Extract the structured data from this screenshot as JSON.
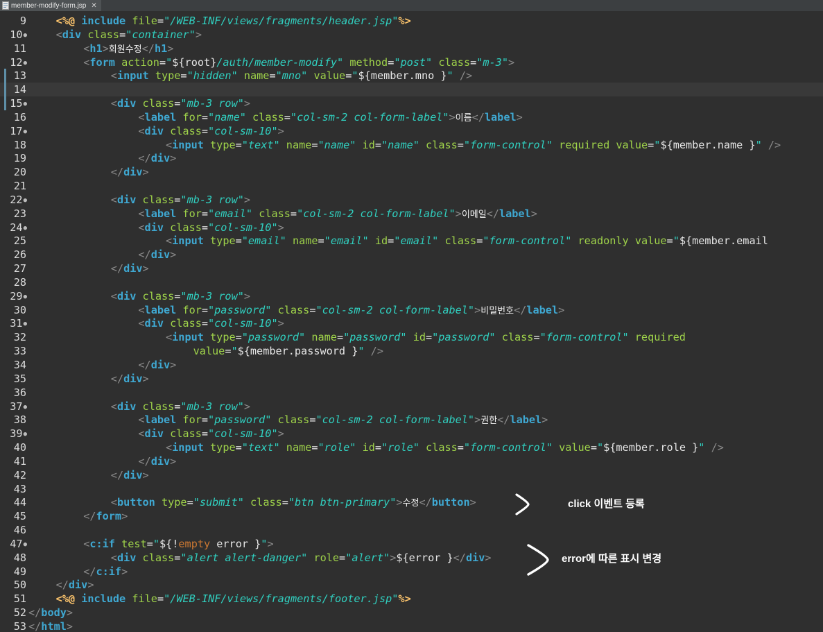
{
  "tab": {
    "filename": "member-modify-form.jsp"
  },
  "editor": {
    "current_line": 14,
    "lines": [
      {
        "n": "9",
        "fold": false,
        "code": "<span class=\"dl\">&lt;%@</span> <span class=\"tg\">include</span> <span class=\"at\">file</span>=<span class=\"st\">\"/WEB-INF/views/fragments/header.jsp\"</span><span class=\"dl\">%&gt;</span>",
        "indent": 2
      },
      {
        "n": "10",
        "fold": true,
        "code": "<span class=\"br\">&lt;</span><span class=\"tg\">div</span> <span class=\"at\">class</span>=<span class=\"st\">\"container\"</span><span class=\"br\">&gt;</span>",
        "indent": 2
      },
      {
        "n": "11",
        "fold": false,
        "code": "<span class=\"br\">&lt;</span><span class=\"tg\">h1</span><span class=\"br\">&gt;</span><span class=\"ko\">회원수정</span><span class=\"br\">&lt;/</span><span class=\"tg\">h1</span><span class=\"br\">&gt;</span>",
        "indent": 4
      },
      {
        "n": "12",
        "fold": true,
        "code": "<span class=\"br\">&lt;</span><span class=\"tg\">form</span> <span class=\"at\">action</span>=<span class=\"st\">\"</span><span class=\"ex\">${root}</span><span class=\"st\">/auth/member-modify\"</span> <span class=\"at\">method</span>=<span class=\"st\">\"post\"</span> <span class=\"at\">class</span>=<span class=\"st\">\"m-3\"</span><span class=\"br\">&gt;</span>",
        "indent": 4
      },
      {
        "n": "13",
        "fold": false,
        "code": "<span class=\"br\">&lt;</span><span class=\"tg\">input</span> <span class=\"at\">type</span>=<span class=\"st\">\"hidden\"</span> <span class=\"at\">name</span>=<span class=\"st\">\"mno\"</span> <span class=\"at\">value</span>=<span class=\"st\">\"</span><span class=\"ex\">${member.mno }</span><span class=\"st\">\"</span> <span class=\"br\">/&gt;</span>",
        "indent": 6,
        "change": true
      },
      {
        "n": "14",
        "fold": false,
        "code": "",
        "indent": 0,
        "change": true
      },
      {
        "n": "15",
        "fold": true,
        "code": "<span class=\"br\">&lt;</span><span class=\"tg\">div</span> <span class=\"at\">class</span>=<span class=\"st\">\"mb-3 row\"</span><span class=\"br\">&gt;</span>",
        "indent": 6,
        "change": true
      },
      {
        "n": "16",
        "fold": false,
        "code": "<span class=\"br\">&lt;</span><span class=\"tg\">label</span> <span class=\"at\">for</span>=<span class=\"st\">\"name\"</span> <span class=\"at\">class</span>=<span class=\"st\">\"col-sm-2 col-form-label\"</span><span class=\"br\">&gt;</span><span class=\"ko\">이름</span><span class=\"br\">&lt;/</span><span class=\"tg\">label</span><span class=\"br\">&gt;</span>",
        "indent": 8
      },
      {
        "n": "17",
        "fold": true,
        "code": "<span class=\"br\">&lt;</span><span class=\"tg\">div</span> <span class=\"at\">class</span>=<span class=\"st\">\"col-sm-10\"</span><span class=\"br\">&gt;</span>",
        "indent": 8
      },
      {
        "n": "18",
        "fold": false,
        "code": "<span class=\"br\">&lt;</span><span class=\"tg\">input</span> <span class=\"at\">type</span>=<span class=\"st\">\"text\"</span> <span class=\"at\">name</span>=<span class=\"st\">\"name\"</span> <span class=\"at\">id</span>=<span class=\"st\">\"name\"</span> <span class=\"at\">class</span>=<span class=\"st\">\"form-control\"</span> <span class=\"at\">required</span> <span class=\"at\">value</span>=<span class=\"st\">\"</span><span class=\"ex\">${member.name }</span><span class=\"st\">\"</span> <span class=\"br\">/&gt;</span>",
        "indent": 10
      },
      {
        "n": "19",
        "fold": false,
        "code": "<span class=\"br\">&lt;/</span><span class=\"tg\">div</span><span class=\"br\">&gt;</span>",
        "indent": 8
      },
      {
        "n": "20",
        "fold": false,
        "code": "<span class=\"br\">&lt;/</span><span class=\"tg\">div</span><span class=\"br\">&gt;</span>",
        "indent": 6
      },
      {
        "n": "21",
        "fold": false,
        "code": "",
        "indent": 0
      },
      {
        "n": "22",
        "fold": true,
        "code": "<span class=\"br\">&lt;</span><span class=\"tg\">div</span> <span class=\"at\">class</span>=<span class=\"st\">\"mb-3 row\"</span><span class=\"br\">&gt;</span>",
        "indent": 6
      },
      {
        "n": "23",
        "fold": false,
        "code": "<span class=\"br\">&lt;</span><span class=\"tg\">label</span> <span class=\"at\">for</span>=<span class=\"st\">\"email\"</span> <span class=\"at\">class</span>=<span class=\"st\">\"col-sm-2 col-form-label\"</span><span class=\"br\">&gt;</span><span class=\"ko\">이메일</span><span class=\"br\">&lt;/</span><span class=\"tg\">label</span><span class=\"br\">&gt;</span>",
        "indent": 8
      },
      {
        "n": "24",
        "fold": true,
        "code": "<span class=\"br\">&lt;</span><span class=\"tg\">div</span> <span class=\"at\">class</span>=<span class=\"st\">\"col-sm-10\"</span><span class=\"br\">&gt;</span>",
        "indent": 8
      },
      {
        "n": "25",
        "fold": false,
        "code": "<span class=\"br\">&lt;</span><span class=\"tg\">input</span> <span class=\"at\">type</span>=<span class=\"st\">\"email\"</span> <span class=\"at\">name</span>=<span class=\"st\">\"email\"</span> <span class=\"at\">id</span>=<span class=\"st\">\"email\"</span> <span class=\"at\">class</span>=<span class=\"st\">\"form-control\"</span> <span class=\"at\">readonly</span> <span class=\"at\">value</span>=<span class=\"st\">\"</span><span class=\"ex\">${member.email</span>",
        "indent": 10
      },
      {
        "n": "26",
        "fold": false,
        "code": "<span class=\"br\">&lt;/</span><span class=\"tg\">div</span><span class=\"br\">&gt;</span>",
        "indent": 8
      },
      {
        "n": "27",
        "fold": false,
        "code": "<span class=\"br\">&lt;/</span><span class=\"tg\">div</span><span class=\"br\">&gt;</span>",
        "indent": 6
      },
      {
        "n": "28",
        "fold": false,
        "code": "",
        "indent": 0
      },
      {
        "n": "29",
        "fold": true,
        "code": "<span class=\"br\">&lt;</span><span class=\"tg\">div</span> <span class=\"at\">class</span>=<span class=\"st\">\"mb-3 row\"</span><span class=\"br\">&gt;</span>",
        "indent": 6
      },
      {
        "n": "30",
        "fold": false,
        "code": "<span class=\"br\">&lt;</span><span class=\"tg\">label</span> <span class=\"at\">for</span>=<span class=\"st\">\"password\"</span> <span class=\"at\">class</span>=<span class=\"st\">\"col-sm-2 col-form-label\"</span><span class=\"br\">&gt;</span><span class=\"ko\">비밀번호</span><span class=\"br\">&lt;/</span><span class=\"tg\">label</span><span class=\"br\">&gt;</span>",
        "indent": 8
      },
      {
        "n": "31",
        "fold": true,
        "code": "<span class=\"br\">&lt;</span><span class=\"tg\">div</span> <span class=\"at\">class</span>=<span class=\"st\">\"col-sm-10\"</span><span class=\"br\">&gt;</span>",
        "indent": 8
      },
      {
        "n": "32",
        "fold": false,
        "code": "<span class=\"br\">&lt;</span><span class=\"tg\">input</span> <span class=\"at\">type</span>=<span class=\"st\">\"password\"</span> <span class=\"at\">name</span>=<span class=\"st\">\"password\"</span> <span class=\"at\">id</span>=<span class=\"st\">\"password\"</span> <span class=\"at\">class</span>=<span class=\"st\">\"form-control\"</span> <span class=\"at\">required</span>",
        "indent": 10
      },
      {
        "n": "33",
        "fold": false,
        "code": "<span class=\"at\">value</span>=<span class=\"st\">\"</span><span class=\"ex\">${member.password }</span><span class=\"st\">\"</span> <span class=\"br\">/&gt;</span>",
        "indent": 12
      },
      {
        "n": "34",
        "fold": false,
        "code": "<span class=\"br\">&lt;/</span><span class=\"tg\">div</span><span class=\"br\">&gt;</span>",
        "indent": 8
      },
      {
        "n": "35",
        "fold": false,
        "code": "<span class=\"br\">&lt;/</span><span class=\"tg\">div</span><span class=\"br\">&gt;</span>",
        "indent": 6
      },
      {
        "n": "36",
        "fold": false,
        "code": "",
        "indent": 0
      },
      {
        "n": "37",
        "fold": true,
        "code": "<span class=\"br\">&lt;</span><span class=\"tg\">div</span> <span class=\"at\">class</span>=<span class=\"st\">\"mb-3 row\"</span><span class=\"br\">&gt;</span>",
        "indent": 6
      },
      {
        "n": "38",
        "fold": false,
        "code": "<span class=\"br\">&lt;</span><span class=\"tg\">label</span> <span class=\"at\">for</span>=<span class=\"st\">\"password\"</span> <span class=\"at\">class</span>=<span class=\"st\">\"col-sm-2 col-form-label\"</span><span class=\"br\">&gt;</span><span class=\"ko\">권한</span><span class=\"br\">&lt;/</span><span class=\"tg\">label</span><span class=\"br\">&gt;</span>",
        "indent": 8
      },
      {
        "n": "39",
        "fold": true,
        "code": "<span class=\"br\">&lt;</span><span class=\"tg\">div</span> <span class=\"at\">class</span>=<span class=\"st\">\"col-sm-10\"</span><span class=\"br\">&gt;</span>",
        "indent": 8
      },
      {
        "n": "40",
        "fold": false,
        "code": "<span class=\"br\">&lt;</span><span class=\"tg\">input</span> <span class=\"at\">type</span>=<span class=\"st\">\"text\"</span> <span class=\"at\">name</span>=<span class=\"st\">\"role\"</span> <span class=\"at\">id</span>=<span class=\"st\">\"role\"</span> <span class=\"at\">class</span>=<span class=\"st\">\"form-control\"</span> <span class=\"at\">value</span>=<span class=\"st\">\"</span><span class=\"ex\">${member.role }</span><span class=\"st\">\"</span> <span class=\"br\">/&gt;</span>",
        "indent": 10
      },
      {
        "n": "41",
        "fold": false,
        "code": "<span class=\"br\">&lt;/</span><span class=\"tg\">div</span><span class=\"br\">&gt;</span>",
        "indent": 8
      },
      {
        "n": "42",
        "fold": false,
        "code": "<span class=\"br\">&lt;/</span><span class=\"tg\">div</span><span class=\"br\">&gt;</span>",
        "indent": 6
      },
      {
        "n": "43",
        "fold": false,
        "code": "",
        "indent": 0
      },
      {
        "n": "44",
        "fold": false,
        "code": "<span class=\"br\">&lt;</span><span class=\"tg\">button</span> <span class=\"at\">type</span>=<span class=\"st\">\"submit\"</span> <span class=\"at\">class</span>=<span class=\"st\">\"btn btn-primary\"</span><span class=\"br\">&gt;</span><span class=\"ko\">수정</span><span class=\"br\">&lt;/</span><span class=\"tg\">button</span><span class=\"br\">&gt;</span>",
        "indent": 6
      },
      {
        "n": "45",
        "fold": false,
        "code": "<span class=\"br\">&lt;/</span><span class=\"tg\">form</span><span class=\"br\">&gt;</span>",
        "indent": 4
      },
      {
        "n": "46",
        "fold": false,
        "code": "",
        "indent": 0
      },
      {
        "n": "47",
        "fold": true,
        "code": "<span class=\"br\">&lt;</span><span class=\"tg\">c:if</span> <span class=\"at\">test</span>=<span class=\"st\">\"</span><span class=\"ex\">${!</span><span class=\"kw\">empty</span><span class=\"ex\"> error }</span><span class=\"st\">\"</span><span class=\"br\">&gt;</span>",
        "indent": 4
      },
      {
        "n": "48",
        "fold": false,
        "code": "<span class=\"br\">&lt;</span><span class=\"tg\">div</span> <span class=\"at\">class</span>=<span class=\"st\">\"alert alert-danger\"</span> <span class=\"at\">role</span>=<span class=\"st\">\"alert\"</span><span class=\"br\">&gt;</span><span class=\"ex\">${error }</span><span class=\"br\">&lt;/</span><span class=\"tg\">div</span><span class=\"br\">&gt;</span>",
        "indent": 6
      },
      {
        "n": "49",
        "fold": false,
        "code": "<span class=\"br\">&lt;/</span><span class=\"tg\">c:if</span><span class=\"br\">&gt;</span>",
        "indent": 4
      },
      {
        "n": "50",
        "fold": false,
        "code": "<span class=\"br\">&lt;/</span><span class=\"tg\">div</span><span class=\"br\">&gt;</span>",
        "indent": 2
      },
      {
        "n": "51",
        "fold": false,
        "code": "<span class=\"dl\">&lt;%@</span> <span class=\"tg\">include</span> <span class=\"at\">file</span>=<span class=\"st\">\"/WEB-INF/views/fragments/footer.jsp\"</span><span class=\"dl\">%&gt;</span>",
        "indent": 2
      },
      {
        "n": "52",
        "fold": false,
        "code": "<span class=\"br\">&lt;/</span><span class=\"tg\">body</span><span class=\"br\">&gt;</span>",
        "indent": 0
      },
      {
        "n": "53",
        "fold": false,
        "code": "<span class=\"br\">&lt;/</span><span class=\"tg\">html</span><span class=\"br\">&gt;</span>",
        "indent": 0
      }
    ]
  },
  "annotations": {
    "click_event": "click 이벤트 등록",
    "error_display": "error에 따른 표시 변경"
  }
}
